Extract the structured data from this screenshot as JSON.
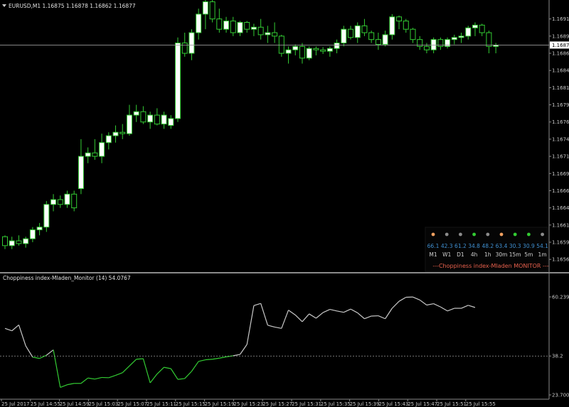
{
  "header": {
    "symbol_title": "EURUSD,M1  1.16875 1.16878 1.16862 1.16877"
  },
  "indicator": {
    "title": "Choppiness index-Mladen_Monitor (14) 54.0767"
  },
  "monitor": {
    "title": "---Choppiness index-Mladen MONITOR ---",
    "items": [
      {
        "tf": "M1",
        "value": "66.1",
        "dot": "#f0a060"
      },
      {
        "tf": "W1",
        "value": "42.3",
        "dot": "#8c8c8c"
      },
      {
        "tf": "D1",
        "value": "61.2",
        "dot": "#8c8c8c"
      },
      {
        "tf": "4h",
        "value": "34.8",
        "dot": "#33cc33"
      },
      {
        "tf": "1h",
        "value": "48.2",
        "dot": "#8c8c8c"
      },
      {
        "tf": "30m",
        "value": "63.4",
        "dot": "#f0a060"
      },
      {
        "tf": "15m",
        "value": "30.3",
        "dot": "#33cc33"
      },
      {
        "tf": "5m",
        "value": "30.9",
        "dot": "#33cc33"
      },
      {
        "tf": "1m",
        "value": "54.1",
        "dot": "#8c8c8c"
      }
    ]
  },
  "colors": {
    "background": "#000000",
    "bull_candle": "#ffffff",
    "bear_candle": "#000000",
    "wick": "#33cc33",
    "indicator_high": "#c8c8c8",
    "indicator_low": "#33cc33",
    "text": "#c8c8c8"
  },
  "chart_data": [
    {
      "type": "candlestick",
      "price_labels": [
        "1.16915",
        "1.16890",
        "1.16865",
        "1.16840",
        "1.16815",
        "1.16790",
        "1.16765",
        "1.16740",
        "1.16715",
        "1.16690",
        "1.16665",
        "1.16640",
        "1.16615",
        "1.16590",
        "1.16565"
      ],
      "current_price_label": "1.16877",
      "current_price": 1.16877,
      "ylim": [
        1.1656,
        1.16925
      ],
      "candles": [
        [
          1.16598,
          1.166,
          1.1658,
          1.16585
        ],
        [
          1.16585,
          1.16598,
          1.1658,
          1.16592
        ],
        [
          1.16592,
          1.166,
          1.16585,
          1.16588
        ],
        [
          1.16588,
          1.16598,
          1.16582,
          1.16595
        ],
        [
          1.16595,
          1.16612,
          1.1659,
          1.16608
        ],
        [
          1.16608,
          1.16618,
          1.166,
          1.16612
        ],
        [
          1.16612,
          1.1665,
          1.16605,
          1.16645
        ],
        [
          1.16645,
          1.1666,
          1.16635,
          1.16652
        ],
        [
          1.16652,
          1.16658,
          1.1664,
          1.16645
        ],
        [
          1.16645,
          1.16665,
          1.1664,
          1.1666
        ],
        [
          1.1666,
          1.16665,
          1.16635,
          1.1664
        ],
        [
          1.16668,
          1.1674,
          1.1666,
          1.16715
        ],
        [
          1.16715,
          1.16728,
          1.16705,
          1.1672
        ],
        [
          1.1672,
          1.1674,
          1.1671,
          1.16715
        ],
        [
          1.16715,
          1.16748,
          1.16705,
          1.16735
        ],
        [
          1.16735,
          1.1675,
          1.16725,
          1.16745
        ],
        [
          1.16745,
          1.1676,
          1.16735,
          1.1675
        ],
        [
          1.1675,
          1.16762,
          1.1674,
          1.16748
        ],
        [
          1.16748,
          1.1679,
          1.16745,
          1.16775
        ],
        [
          1.16775,
          1.1679,
          1.16765,
          1.1678
        ],
        [
          1.1678,
          1.16788,
          1.16762,
          1.16765
        ],
        [
          1.16765,
          1.1678,
          1.16755,
          1.16775
        ],
        [
          1.16775,
          1.16785,
          1.1676,
          1.16762
        ],
        [
          1.16762,
          1.1678,
          1.16755,
          1.16775
        ],
        [
          1.1676,
          1.16775,
          1.16755,
          1.1677
        ],
        [
          1.1677,
          1.16888,
          1.16765,
          1.1688
        ],
        [
          1.1688,
          1.16895,
          1.1686,
          1.16865
        ],
        [
          1.16865,
          1.169,
          1.16855,
          1.16895
        ],
        [
          1.16895,
          1.1693,
          1.16885,
          1.16922
        ],
        [
          1.16922,
          1.16952,
          1.169,
          1.1694
        ],
        [
          1.1694,
          1.16945,
          1.1691,
          1.16915
        ],
        [
          1.16915,
          1.1693,
          1.16895,
          1.169
        ],
        [
          1.169,
          1.16918,
          1.16895,
          1.16912
        ],
        [
          1.16912,
          1.16918,
          1.1689,
          1.16895
        ],
        [
          1.16895,
          1.16912,
          1.1689,
          1.1691
        ],
        [
          1.1691,
          1.16912,
          1.16895,
          1.169
        ],
        [
          1.169,
          1.16908,
          1.1689,
          1.16903
        ],
        [
          1.16903,
          1.16915,
          1.16885,
          1.16892
        ],
        [
          1.16892,
          1.16905,
          1.1688,
          1.16895
        ],
        [
          1.16895,
          1.1691,
          1.1688,
          1.1689
        ],
        [
          1.1689,
          1.16892,
          1.1686,
          1.16865
        ],
        [
          1.16865,
          1.16875,
          1.1685,
          1.1687
        ],
        [
          1.1687,
          1.16878,
          1.16862,
          1.16875
        ],
        [
          1.16875,
          1.1688,
          1.1685,
          1.16858
        ],
        [
          1.16858,
          1.16875,
          1.16855,
          1.16872
        ],
        [
          1.16872,
          1.16875,
          1.16862,
          1.1687
        ],
        [
          1.1687,
          1.16874,
          1.16864,
          1.16868
        ],
        [
          1.16868,
          1.16875,
          1.1686,
          1.16872
        ],
        [
          1.16872,
          1.16885,
          1.16865,
          1.1688
        ],
        [
          1.1688,
          1.16905,
          1.16875,
          1.169
        ],
        [
          1.169,
          1.16905,
          1.16885,
          1.16888
        ],
        [
          1.16888,
          1.1691,
          1.1688,
          1.16905
        ],
        [
          1.16905,
          1.16915,
          1.1689,
          1.16895
        ],
        [
          1.16895,
          1.16898,
          1.1688,
          1.16885
        ],
        [
          1.16885,
          1.16895,
          1.1687,
          1.16878
        ],
        [
          1.16878,
          1.16898,
          1.16875,
          1.16892
        ],
        [
          1.16892,
          1.16922,
          1.16885,
          1.16918
        ],
        [
          1.16918,
          1.1692,
          1.169,
          1.16912
        ],
        [
          1.16912,
          1.16915,
          1.16895,
          1.169
        ],
        [
          1.169,
          1.16902,
          1.1688,
          1.16885
        ],
        [
          1.16885,
          1.1689,
          1.1687,
          1.16875
        ],
        [
          1.16875,
          1.1688,
          1.16865,
          1.1687
        ],
        [
          1.1687,
          1.16888,
          1.16865,
          1.16885
        ],
        [
          1.16885,
          1.16888,
          1.1687,
          1.16875
        ],
        [
          1.16875,
          1.16888,
          1.16872,
          1.16885
        ],
        [
          1.16885,
          1.16892,
          1.16878,
          1.16888
        ],
        [
          1.16888,
          1.16895,
          1.1688,
          1.1689
        ],
        [
          1.1689,
          1.16905,
          1.16885,
          1.16902
        ],
        [
          1.16902,
          1.1691,
          1.1689,
          1.16906
        ],
        [
          1.16906,
          1.16908,
          1.1689,
          1.16895
        ],
        [
          1.16895,
          1.16898,
          1.16865,
          1.16875
        ],
        [
          1.16875,
          1.1688,
          1.16865,
          1.16877
        ]
      ]
    },
    {
      "type": "line",
      "scale_labels": [
        "60.2395",
        "38.2",
        "23.7007"
      ],
      "ylim": [
        23.7007,
        60.2395
      ],
      "level": 38.2,
      "values": [
        48.5,
        47.6,
        49.8,
        42.0,
        37.8,
        37.3,
        38.5,
        40.5,
        26.5,
        27.5,
        28.0,
        28.0,
        30.0,
        29.6,
        30.2,
        30.1,
        31.0,
        32.0,
        34.5,
        37.0,
        37.2,
        28.2,
        31.5,
        34.0,
        33.5,
        29.5,
        29.8,
        32.5,
        36.2,
        36.8,
        37.0,
        37.4,
        37.9,
        38.3,
        38.8,
        42.5,
        57.0,
        57.8,
        49.7,
        49.0,
        48.5,
        55.3,
        53.5,
        51.0,
        53.9,
        52.3,
        54.4,
        55.6,
        55.0,
        54.5,
        55.7,
        54.3,
        52.1,
        53.1,
        53.2,
        52.1,
        56.0,
        58.6,
        60.1,
        60.2,
        59.1,
        57.2,
        57.7,
        56.5,
        55.0,
        56.0,
        56.0,
        57.1,
        56.3
      ]
    }
  ],
  "time_axis": {
    "labels": [
      "25 Jul 2017",
      "25 Jul 14:55",
      "25 Jul 14:59",
      "25 Jul 15:03",
      "25 Jul 15:07",
      "25 Jul 15:11",
      "25 Jul 15:15",
      "25 Jul 15:19",
      "25 Jul 15:23",
      "25 Jul 15:27",
      "25 Jul 15:31",
      "25 Jul 15:35",
      "25 Jul 15:39",
      "25 Jul 15:43",
      "25 Jul 15:47",
      "25 Jul 15:51",
      "25 Jul 15:55"
    ]
  }
}
